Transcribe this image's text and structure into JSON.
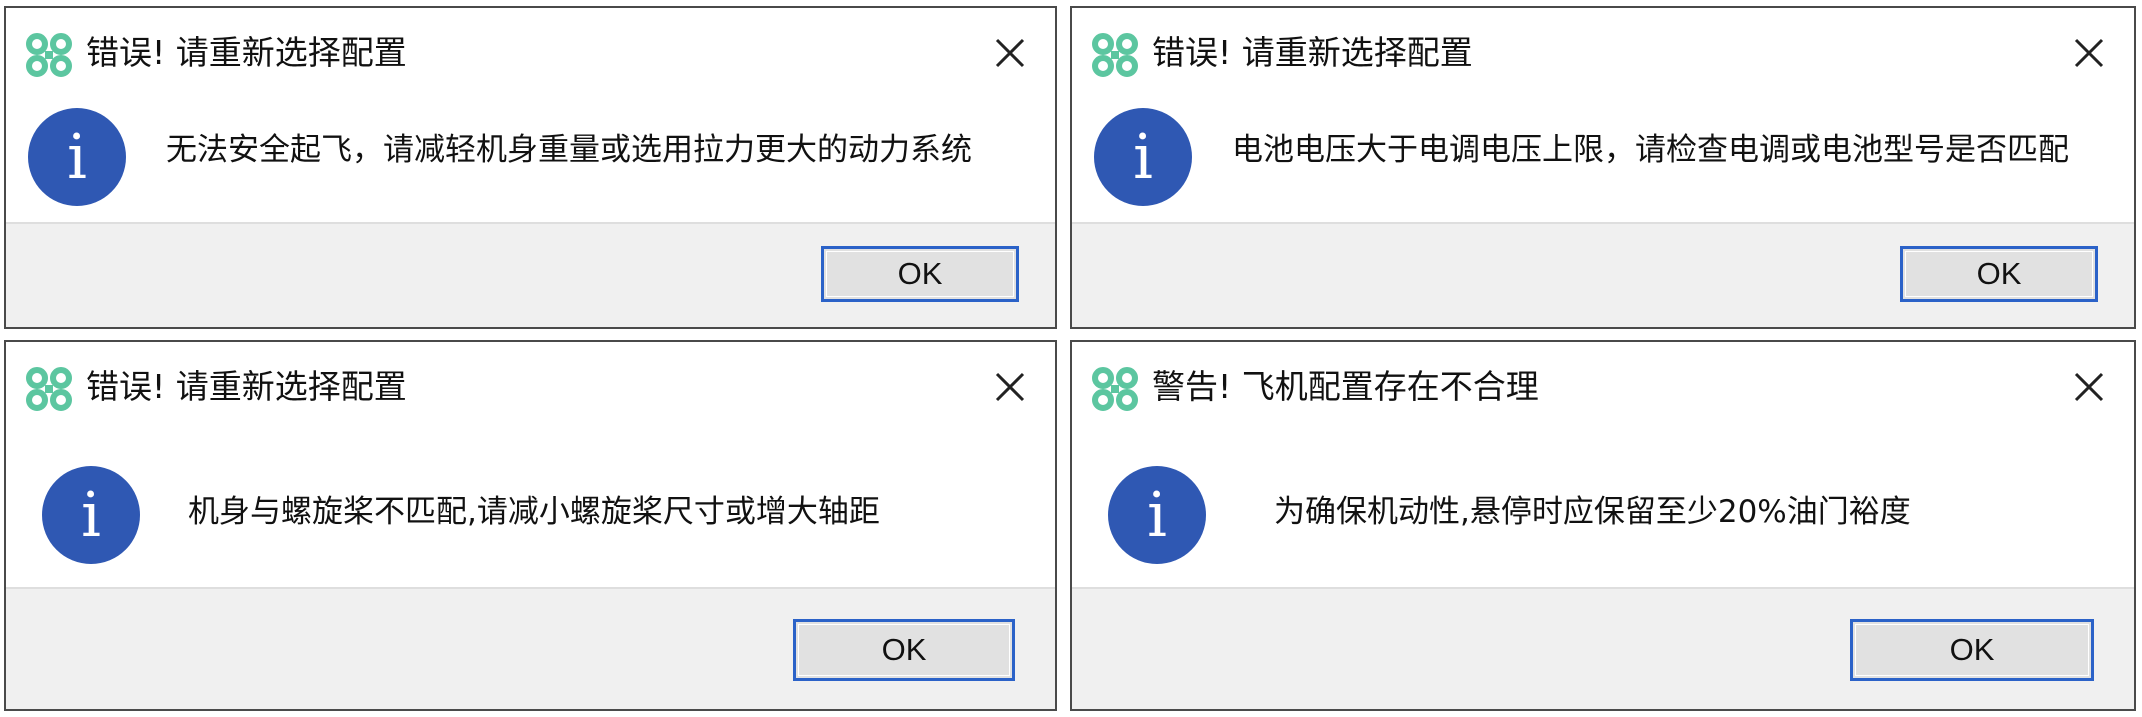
{
  "dialogs": [
    {
      "title": "错误! 请重新选择配置",
      "message": "无法安全起飞，请减轻机身重量或选用拉力更大的动力系统",
      "info_glyph": "i",
      "ok_label": "OK",
      "icon": "drone-logo-icon"
    },
    {
      "title": "错误! 请重新选择配置",
      "message": "电池电压大于电调电压上限，请检查电调或电池型号是否匹配",
      "info_glyph": "i",
      "ok_label": "OK",
      "icon": "drone-logo-icon"
    },
    {
      "title": "错误! 请重新选择配置",
      "message": "机身与螺旋桨不匹配,请减小螺旋桨尺寸或增大轴距",
      "info_glyph": "i",
      "ok_label": "OK",
      "icon": "drone-logo-icon"
    },
    {
      "title": "警告! 飞机配置存在不合理",
      "message": "为确保机动性,悬停时应保留至少20%油门裕度",
      "info_glyph": "i",
      "ok_label": "OK",
      "icon": "drone-logo-icon"
    }
  ],
  "colors": {
    "logo": "#5cc6a0",
    "info_circle": "#2f58b3",
    "button_border": "#2b62c8",
    "footer_bg": "#f0f0f0"
  }
}
